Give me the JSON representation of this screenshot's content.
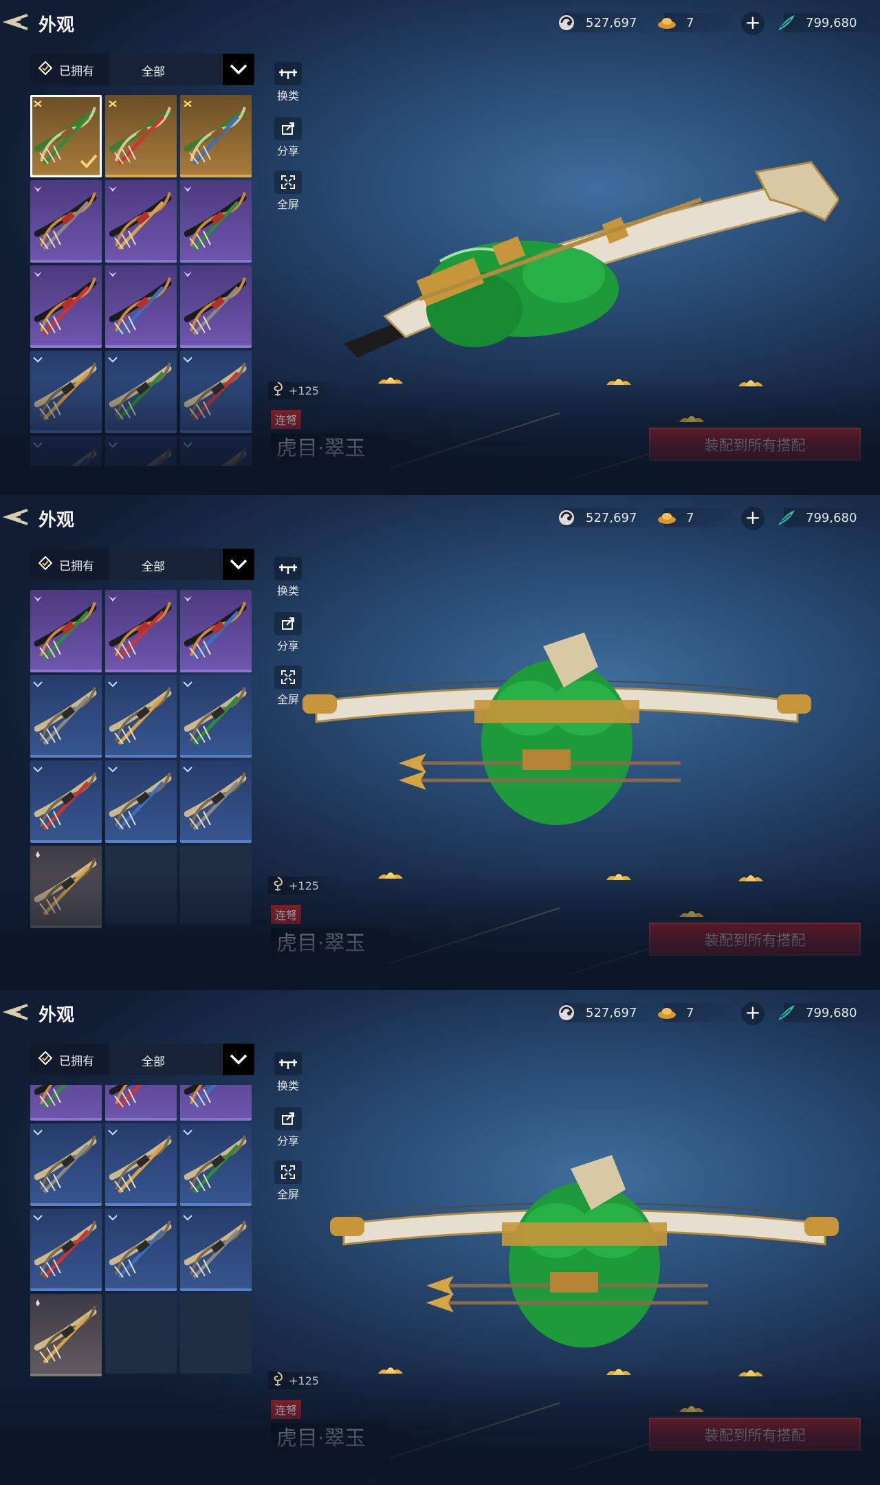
{
  "header": {
    "title": "外观",
    "currencies": [
      {
        "icon": "coin-swirl-icon",
        "value": "527,697"
      },
      {
        "icon": "gold-ingot-icon",
        "value": "7"
      },
      {
        "icon": "jade-feather-icon",
        "value": "799,680"
      }
    ],
    "add_label": "+"
  },
  "filter": {
    "owned_label": "已拥有",
    "category_label": "全部"
  },
  "tools": [
    {
      "icon": "crossbow-swap-icon",
      "label": "换类"
    },
    {
      "icon": "share-icon",
      "label": "分享"
    },
    {
      "icon": "fullscreen-icon",
      "label": "全屏"
    }
  ],
  "item": {
    "bonus": "+125",
    "type_tag": "连弩",
    "name": "虎目·翠玉",
    "equip_label": "装配到所有搭配"
  },
  "colors": {
    "equip": "#b32129",
    "tag": "#b0242a",
    "jade": "#1f9a3a",
    "ivory": "#e6dfcf",
    "gold": "#c7963a"
  },
  "panels": [
    {
      "view": "side",
      "grid": {
        "offset": 0,
        "rows": [
          [
            "gold",
            "gold",
            "gold"
          ],
          [
            "purple",
            "purple",
            "purple"
          ],
          [
            "purple",
            "purple",
            "purple"
          ],
          [
            "blue",
            "blue",
            "blue"
          ],
          [
            "blue",
            "blue",
            "blue"
          ]
        ],
        "selected": [
          0,
          0
        ]
      }
    },
    {
      "view": "front",
      "grid": {
        "offset": 0,
        "rows": [
          [
            "purple",
            "purple",
            "purple"
          ],
          [
            "blue",
            "blue",
            "blue"
          ],
          [
            "blue",
            "blue",
            "blue"
          ],
          [
            "brown",
            "empty",
            "empty"
          ]
        ],
        "selected": null
      }
    },
    {
      "view": "front-wide",
      "grid": {
        "offset": -68,
        "rows": [
          [
            "purple",
            "purple",
            "purple"
          ],
          [
            "blue",
            "blue",
            "blue"
          ],
          [
            "blue",
            "blue",
            "blue"
          ],
          [
            "brown",
            "empty",
            "empty"
          ]
        ],
        "selected": null
      }
    }
  ]
}
